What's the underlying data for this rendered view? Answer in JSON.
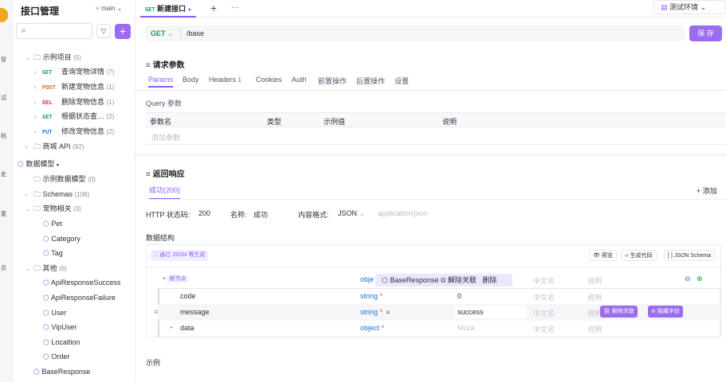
{
  "rail": {
    "labels": [
      "管",
      "试",
      "档",
      "史",
      "置",
      "员"
    ]
  },
  "sidebar": {
    "title": "接口管理",
    "branch": "main",
    "search_placeholder": "",
    "add": "+",
    "items": [
      {
        "type": "folder",
        "label": "示例项目",
        "count": "(5)",
        "arrow": "⌄"
      },
      {
        "type": "api",
        "method": "GET",
        "label": "查询宠物详情",
        "count": "(7)"
      },
      {
        "type": "api",
        "method": "POST",
        "label": "新建宠物信息",
        "count": "(1)"
      },
      {
        "type": "api",
        "method": "DEL",
        "label": "删除宠物信息",
        "count": "(1)"
      },
      {
        "type": "api",
        "method": "GET",
        "label": "根据状态查…",
        "count": "(2)"
      },
      {
        "type": "api",
        "method": "PUT",
        "label": "修改宠物信息",
        "count": "(2)"
      },
      {
        "type": "folder",
        "label": "商城 API",
        "count": "(92)",
        "arrow": "›"
      },
      {
        "type": "section",
        "label": "数据模型"
      },
      {
        "type": "folder",
        "label": "示例数据模型",
        "count": "(0)",
        "arrow": ""
      },
      {
        "type": "folder",
        "label": "Schemas",
        "count": "(108)",
        "arrow": "›"
      },
      {
        "type": "folder",
        "label": "宠物相关",
        "count": "(3)",
        "arrow": "⌄"
      },
      {
        "type": "model",
        "label": "Pet"
      },
      {
        "type": "model",
        "label": "Category"
      },
      {
        "type": "model",
        "label": "Tag"
      },
      {
        "type": "folder",
        "label": "其他",
        "count": "(6)",
        "arrow": "⌄"
      },
      {
        "type": "model",
        "label": "ApiResponseSuccess"
      },
      {
        "type": "model",
        "label": "ApiResponseFailure"
      },
      {
        "type": "model",
        "label": "User"
      },
      {
        "type": "model",
        "label": "VipUser"
      },
      {
        "type": "model",
        "label": "Localtion"
      },
      {
        "type": "model",
        "label": "Order"
      },
      {
        "type": "model",
        "label": "BaseResponse"
      }
    ]
  },
  "topbar": {
    "tab_method": "GET",
    "tab_label": "新建接口",
    "add": "+",
    "more": "···",
    "env": "测试环境"
  },
  "request": {
    "method": "GET",
    "url": "/base",
    "save": "保 存"
  },
  "params": {
    "title": "请求参数",
    "tabs": [
      "Params",
      "Body",
      "Headers",
      "Cookies",
      "Auth",
      "前置操作",
      "后置操作",
      "设置"
    ],
    "headers_count": "1",
    "query_label": "Query 参数",
    "columns": [
      "参数名",
      "类型",
      "示例值",
      "说明"
    ],
    "add_placeholder": "添加参数"
  },
  "response": {
    "title": "返回响应",
    "tab": "成功(200)",
    "add": "+ 添加",
    "status_label": "HTTP 状态码:",
    "status": "200",
    "name_label": "名称:",
    "name": "成功",
    "format_label": "内容格式:",
    "format": "JSON",
    "format_hint": "application/json",
    "structure_label": "数据结构",
    "gen_btn": "通过 JSON 等生成",
    "preview": "预览",
    "gen_code": "生成代码",
    "json_schema": "JSON Schema",
    "example_label": "示例"
  },
  "schema": {
    "root": {
      "label": "根节点",
      "type": "obje",
      "ref": "BaseResponse",
      "unlink": "解除关联",
      "delete": "删除",
      "cn": "中文名",
      "desc": "说明"
    },
    "rows": [
      {
        "name": "code",
        "type": "string",
        "mock": "0",
        "cn": "中文名",
        "desc": "说明"
      },
      {
        "name": "message",
        "type": "string",
        "flag": "N",
        "mock": "success",
        "cn": "中文名",
        "desc": "说明",
        "unlink": "解除关联",
        "hide": "隐藏字段"
      },
      {
        "name": "data",
        "type": "object",
        "mock": "Mock",
        "cn": "中文名",
        "desc": "说明"
      }
    ]
  }
}
